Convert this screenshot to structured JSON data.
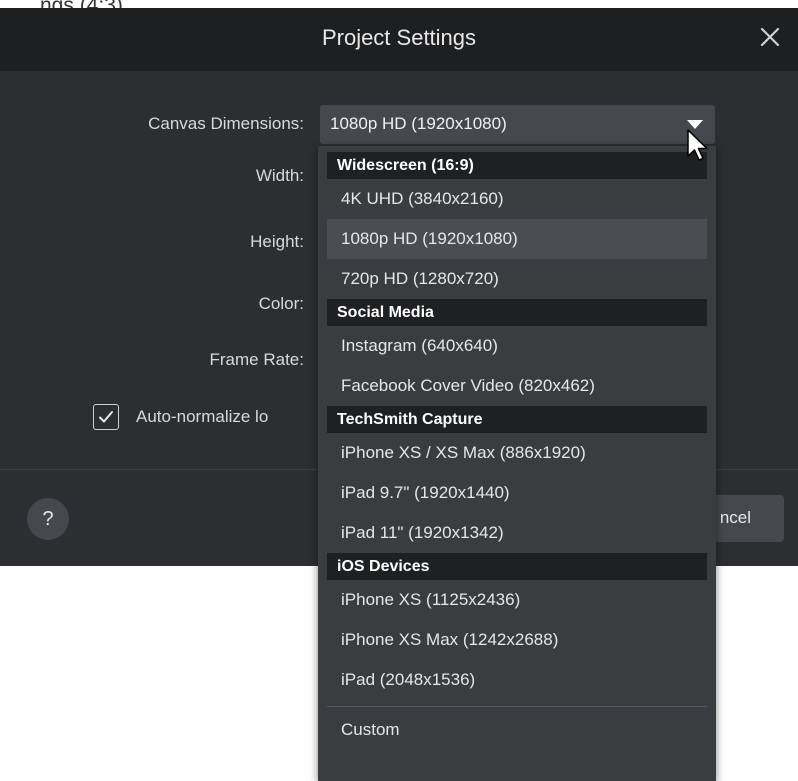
{
  "caption_fragment": "ngs (4:3)",
  "dialog": {
    "title": "Project Settings",
    "close_icon": "close-icon",
    "labels": {
      "canvas_dimensions": "Canvas Dimensions:",
      "width": "Width:",
      "height": "Height:",
      "color": "Color:",
      "frame_rate": "Frame Rate:"
    },
    "canvas_select_value": "1080p HD (1920x1080)",
    "auto_normalize": {
      "label": "Auto-normalize lo",
      "checked": true
    },
    "help_label": "?",
    "cancel_label": "ncel"
  },
  "dropdown": {
    "groups": [
      {
        "header": "Widescreen (16:9)",
        "items": [
          "4K UHD (3840x2160)",
          "1080p HD (1920x1080)",
          "720p HD (1280x720)"
        ]
      },
      {
        "header": "Social Media",
        "items": [
          "Instagram (640x640)",
          "Facebook Cover Video (820x462)"
        ]
      },
      {
        "header": "TechSmith Capture",
        "items": [
          "iPhone XS / XS Max (886x1920)",
          "iPad 9.7\" (1920x1440)",
          "iPad 11\" (1920x1342)"
        ]
      },
      {
        "header": "iOS Devices",
        "items": [
          "iPhone XS (1125x2436)",
          "iPhone XS Max (1242x2688)",
          "iPad (2048x1536)"
        ]
      }
    ],
    "selected_item": "1080p HD (1920x1080)",
    "custom_label": "Custom"
  },
  "colors": {
    "dialog_bg": "#2c2e31",
    "titlebar_bg": "#1e1f21",
    "dropdown_bg": "#3a3c40",
    "header_bg": "#1f2022",
    "selected_bg": "#4a4d52"
  }
}
